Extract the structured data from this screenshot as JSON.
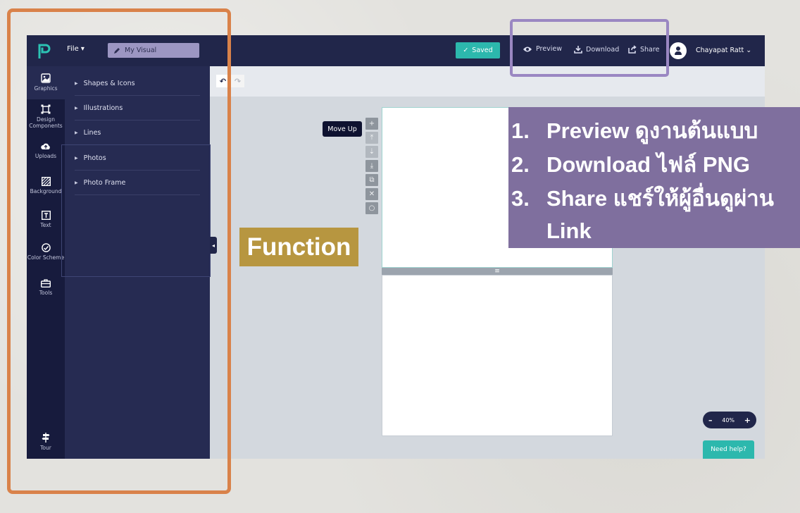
{
  "topbar": {
    "file_label": "File ▾",
    "title_value": "My Visual",
    "saved_label": "Saved",
    "preview_label": "Preview",
    "download_label": "Download",
    "share_label": "Share",
    "user_name": "Chayapat Ratt"
  },
  "sidebar": {
    "items": [
      {
        "label": "Graphics",
        "icon": "image-icon"
      },
      {
        "label": "Design Components",
        "icon": "components-icon"
      },
      {
        "label": "Uploads",
        "icon": "cloud-upload-icon"
      },
      {
        "label": "Background",
        "icon": "background-icon"
      },
      {
        "label": "Text",
        "icon": "text-icon"
      },
      {
        "label": "Color Scheme",
        "icon": "palette-icon"
      },
      {
        "label": "Tools",
        "icon": "toolbox-icon"
      }
    ],
    "tour_label": "Tour"
  },
  "panel": {
    "items": [
      "Shapes & Icons",
      "Illustrations",
      "Lines",
      "Photos",
      "Photo Frame"
    ]
  },
  "canvas": {
    "tooltip": "Move Up",
    "zoom_level": "40%"
  },
  "help_label": "Need help?",
  "annotation": {
    "function_label": "Function",
    "lines": [
      {
        "num": "1.",
        "text": "Preview ดูงานต้นแบบ"
      },
      {
        "num": "2.",
        "text": "Download ไฟล์ PNG"
      },
      {
        "num": "3.",
        "text": "Share แชร์ให้ผู้อื่นดูผ่าน"
      }
    ],
    "continuation": "Link"
  },
  "colors": {
    "topbar": "#21264a",
    "sidebar": "#171b3d",
    "panel": "#262b52",
    "accent_teal": "#2cb8ad",
    "orange_frame": "#d9824a",
    "purple_frame": "#9a87c2",
    "function_label_bg": "#b79640",
    "info_box_bg": "#7f6f9e"
  }
}
